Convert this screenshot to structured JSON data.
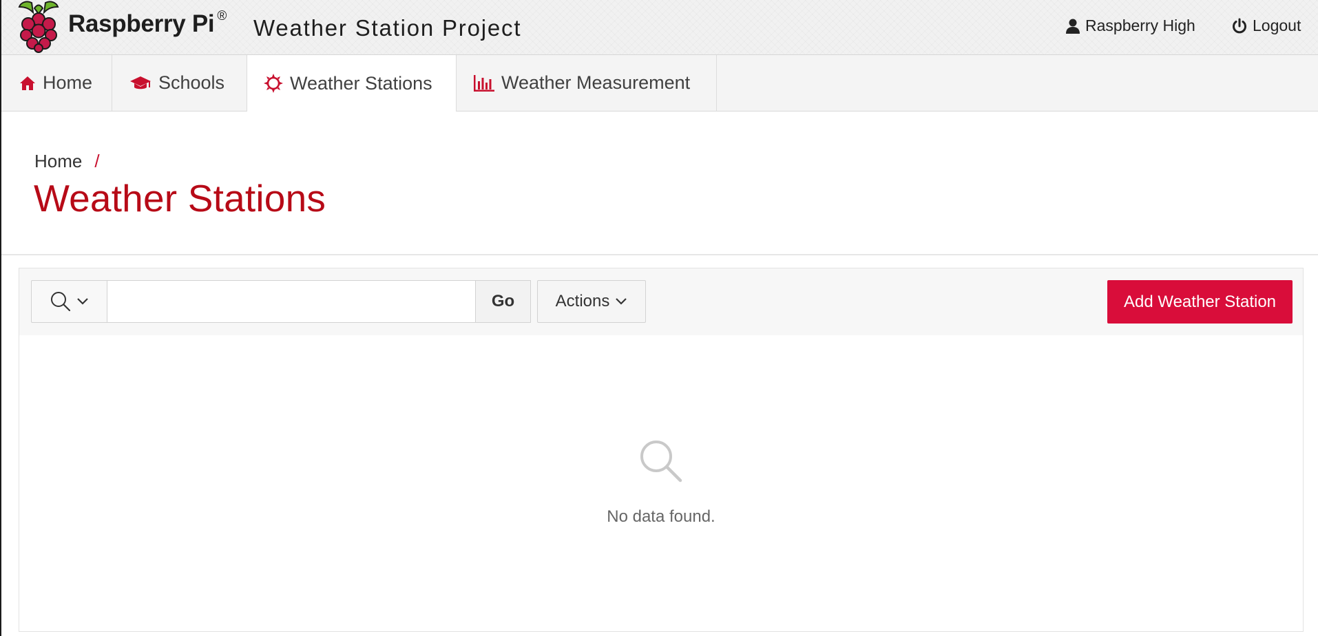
{
  "header": {
    "brand": "Raspberry Pi",
    "brand_mark": "®",
    "project_title": "Weather Station Project",
    "user_label": "Raspberry High",
    "logout_label": "Logout"
  },
  "nav": {
    "tabs": [
      {
        "label": "Home",
        "icon": "home-icon"
      },
      {
        "label": "Schools",
        "icon": "graduation-cap-icon"
      },
      {
        "label": "Weather Stations",
        "icon": "sun-icon",
        "active": true
      },
      {
        "label": "Weather Measurement",
        "icon": "bar-chart-icon"
      }
    ]
  },
  "breadcrumb": {
    "home": "Home",
    "separator": "/"
  },
  "page": {
    "title": "Weather Stations"
  },
  "toolbar": {
    "search_value": "",
    "search_placeholder": "",
    "go_label": "Go",
    "actions_label": "Actions",
    "add_label": "Add Weather Station"
  },
  "report": {
    "empty_message": "No data found."
  },
  "colors": {
    "accent": "#c8102e",
    "title": "#b70a17",
    "button": "#d90d3a"
  }
}
